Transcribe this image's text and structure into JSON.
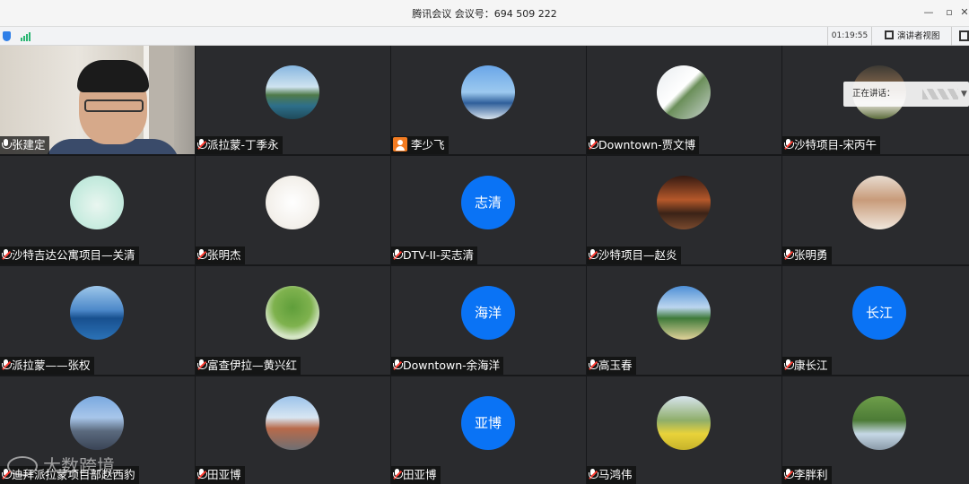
{
  "window": {
    "title": "腾讯会议 会议号：694 509 222",
    "minimize_glyph": "—",
    "restore_glyph": "▫",
    "close_glyph": "✕"
  },
  "toolbar": {
    "shield_icon": "shield-icon",
    "signal_icon": "signal-icon",
    "elapsed_time": "01:19:55",
    "speaker_view_label": "演讲者视图",
    "fullscreen_icon": "fullscreen-icon"
  },
  "speaking_indicator": {
    "label": "正在讲话："
  },
  "participants": [
    {
      "name": "张建定",
      "type": "camera",
      "mic": "on"
    },
    {
      "name": "派拉蒙-丁季永",
      "type": "photo",
      "mic": "muted",
      "photo_desc": "resort-pool"
    },
    {
      "name": "李少飞",
      "type": "photo",
      "mic": "host",
      "photo_desc": "beach"
    },
    {
      "name": "Downtown-贾文博",
      "type": "photo",
      "mic": "muted",
      "photo_desc": "wedding"
    },
    {
      "name": "沙特项目-宋丙午",
      "type": "photo",
      "mic": "muted",
      "photo_desc": "portrait"
    },
    {
      "name": "沙特吉达公寓项目—关清",
      "type": "photo",
      "mic": "muted",
      "photo_desc": "cartoon"
    },
    {
      "name": "张明杰",
      "type": "photo",
      "mic": "muted",
      "photo_desc": "cartoon-girl"
    },
    {
      "name": "DTV-II-买志清",
      "type": "text",
      "mic": "muted",
      "avatar_text": "志清"
    },
    {
      "name": "沙特项目—赵炎",
      "type": "photo",
      "mic": "muted",
      "photo_desc": "stage"
    },
    {
      "name": "张明勇",
      "type": "photo",
      "mic": "muted",
      "photo_desc": "child"
    },
    {
      "name": "派拉蒙——张权",
      "type": "photo",
      "mic": "muted",
      "photo_desc": "sea"
    },
    {
      "name": "富查伊拉—黄兴红",
      "type": "photo",
      "mic": "muted",
      "photo_desc": "tree"
    },
    {
      "name": "Downtown-余海洋",
      "type": "text",
      "mic": "muted",
      "avatar_text": "海洋"
    },
    {
      "name": "高玉春",
      "type": "photo",
      "mic": "muted",
      "photo_desc": "lake"
    },
    {
      "name": "康长江",
      "type": "text",
      "mic": "muted",
      "avatar_text": "长江"
    },
    {
      "name": "迪拜派拉蒙项目部赵西豹",
      "type": "photo",
      "mic": "muted",
      "photo_desc": "skyscraper"
    },
    {
      "name": "田亚博",
      "type": "photo",
      "mic": "muted",
      "photo_desc": "city"
    },
    {
      "name": "田亚博",
      "type": "text",
      "mic": "muted",
      "avatar_text": "亚博"
    },
    {
      "name": "马鸿伟",
      "type": "photo",
      "mic": "muted",
      "photo_desc": "flowers"
    },
    {
      "name": "李胖利",
      "type": "photo",
      "mic": "muted",
      "photo_desc": "garden-arch"
    }
  ],
  "watermark": {
    "text": "大数跨境"
  },
  "colors": {
    "text_avatar_bg": "#0a73f5",
    "tile_bg": "#2a2b2e",
    "grid_bg": "#17181a",
    "muted_red": "#ff3b30"
  }
}
